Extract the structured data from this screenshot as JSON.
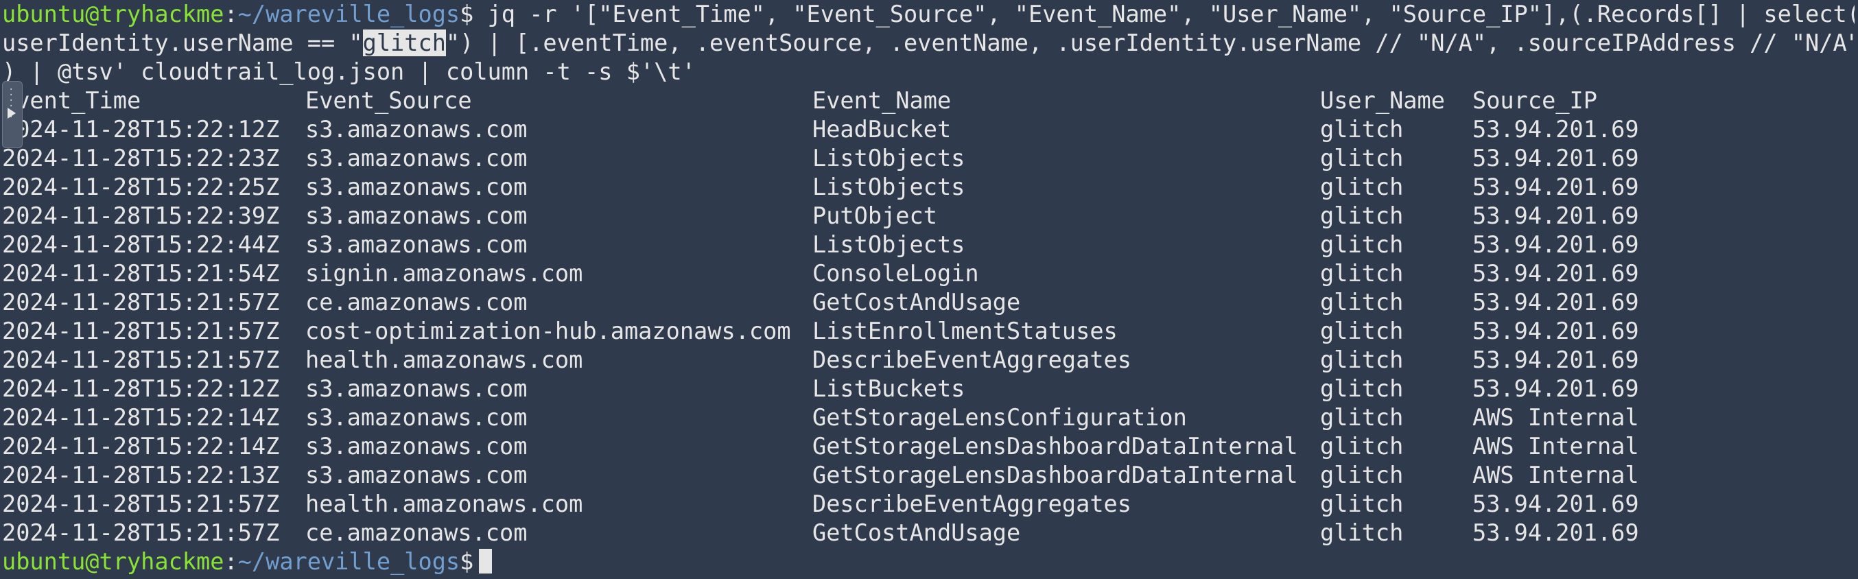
{
  "terminal": {
    "prompt": {
      "user_host": "ubuntu@tryhackme",
      "separator": ":",
      "path": "~/wareville_logs",
      "symbol": "$"
    },
    "command": {
      "part1": " jq -r '[\"Event_Time\", \"Event_Source\", \"Event_Name\", \"User_Name\", \"Source_IP\"],(.Records[] | select(.",
      "part2_before": "userIdentity.userName == \"",
      "part2_highlight": "glitch",
      "part2_after": "\") | [.eventTime, .eventSource, .eventName, .userIdentity.userName // \"N/A\", .sourceIPAddress // \"N/A\"]",
      "part3": ") | @tsv' cloudtrail_log.json | column -t -s $'\\t'"
    },
    "table": {
      "headers": [
        "Event_Time",
        "Event_Source",
        "Event_Name",
        "User_Name",
        "Source_IP"
      ],
      "rows": [
        [
          "2024-11-28T15:22:12Z",
          "s3.amazonaws.com",
          "HeadBucket",
          "glitch",
          "53.94.201.69"
        ],
        [
          "2024-11-28T15:22:23Z",
          "s3.amazonaws.com",
          "ListObjects",
          "glitch",
          "53.94.201.69"
        ],
        [
          "2024-11-28T15:22:25Z",
          "s3.amazonaws.com",
          "ListObjects",
          "glitch",
          "53.94.201.69"
        ],
        [
          "2024-11-28T15:22:39Z",
          "s3.amazonaws.com",
          "PutObject",
          "glitch",
          "53.94.201.69"
        ],
        [
          "2024-11-28T15:22:44Z",
          "s3.amazonaws.com",
          "ListObjects",
          "glitch",
          "53.94.201.69"
        ],
        [
          "2024-11-28T15:21:54Z",
          "signin.amazonaws.com",
          "ConsoleLogin",
          "glitch",
          "53.94.201.69"
        ],
        [
          "2024-11-28T15:21:57Z",
          "ce.amazonaws.com",
          "GetCostAndUsage",
          "glitch",
          "53.94.201.69"
        ],
        [
          "2024-11-28T15:21:57Z",
          "cost-optimization-hub.amazonaws.com",
          "ListEnrollmentStatuses",
          "glitch",
          "53.94.201.69"
        ],
        [
          "2024-11-28T15:21:57Z",
          "health.amazonaws.com",
          "DescribeEventAggregates",
          "glitch",
          "53.94.201.69"
        ],
        [
          "2024-11-28T15:22:12Z",
          "s3.amazonaws.com",
          "ListBuckets",
          "glitch",
          "53.94.201.69"
        ],
        [
          "2024-11-28T15:22:14Z",
          "s3.amazonaws.com",
          "GetStorageLensConfiguration",
          "glitch",
          "AWS Internal"
        ],
        [
          "2024-11-28T15:22:14Z",
          "s3.amazonaws.com",
          "GetStorageLensDashboardDataInternal",
          "glitch",
          "AWS Internal"
        ],
        [
          "2024-11-28T15:22:13Z",
          "s3.amazonaws.com",
          "GetStorageLensDashboardDataInternal",
          "glitch",
          "AWS Internal"
        ],
        [
          "2024-11-28T15:21:57Z",
          "health.amazonaws.com",
          "DescribeEventAggregates",
          "glitch",
          "53.94.201.69"
        ],
        [
          "2024-11-28T15:21:57Z",
          "ce.amazonaws.com",
          "GetCostAndUsage",
          "glitch",
          "53.94.201.69"
        ]
      ]
    },
    "colors": {
      "background": "#2f3b4d",
      "text": "#e6e6e6",
      "user_host": "#8ae234",
      "path": "#729fcf"
    }
  },
  "side_handle": {
    "icon": "play-icon"
  }
}
